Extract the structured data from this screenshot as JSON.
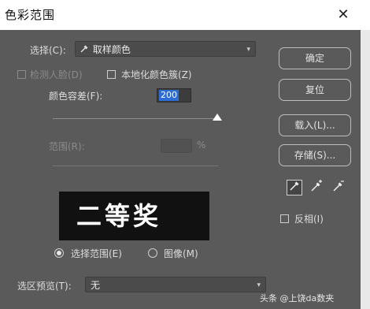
{
  "window": {
    "title": "色彩范围",
    "close_glyph": "✕"
  },
  "select_row": {
    "label": "选择(C):",
    "value": "取样颜色",
    "arrow": "▾"
  },
  "localized_clusters": {
    "label": "检测人脸(D)",
    "checked": false
  },
  "local_color": {
    "label": "本地化颜色簇(Z)",
    "checked": false
  },
  "fuzziness": {
    "label": "颜色容差(F):",
    "value": "200",
    "slider_level": 1.0
  },
  "range": {
    "label": "范围(R):",
    "value": "",
    "unit": "%"
  },
  "preview": {
    "text": "二等奖"
  },
  "view_options": [
    {
      "label": "选择范围(E)",
      "selected": true
    },
    {
      "label": "图像(M)",
      "selected": false
    }
  ],
  "buttons": {
    "ok": "确定",
    "reset": "复位",
    "load": "载入(L)...",
    "save": "存储(S)..."
  },
  "eyedroppers": [
    {
      "icon": "eyedropper-icon"
    },
    {
      "icon": "eyedropper-plus-icon"
    },
    {
      "icon": "eyedropper-minus-icon"
    }
  ],
  "invert": {
    "label": "反相(I)",
    "checked": false
  },
  "selection_preview": {
    "label": "选区预览(T):",
    "value": "无",
    "arrow": "▾"
  },
  "watermark": "头条 @上饶da数夹",
  "colors": {
    "dialog_bg": "#5a5a5a",
    "field_highlight": "#2d6ed6"
  }
}
